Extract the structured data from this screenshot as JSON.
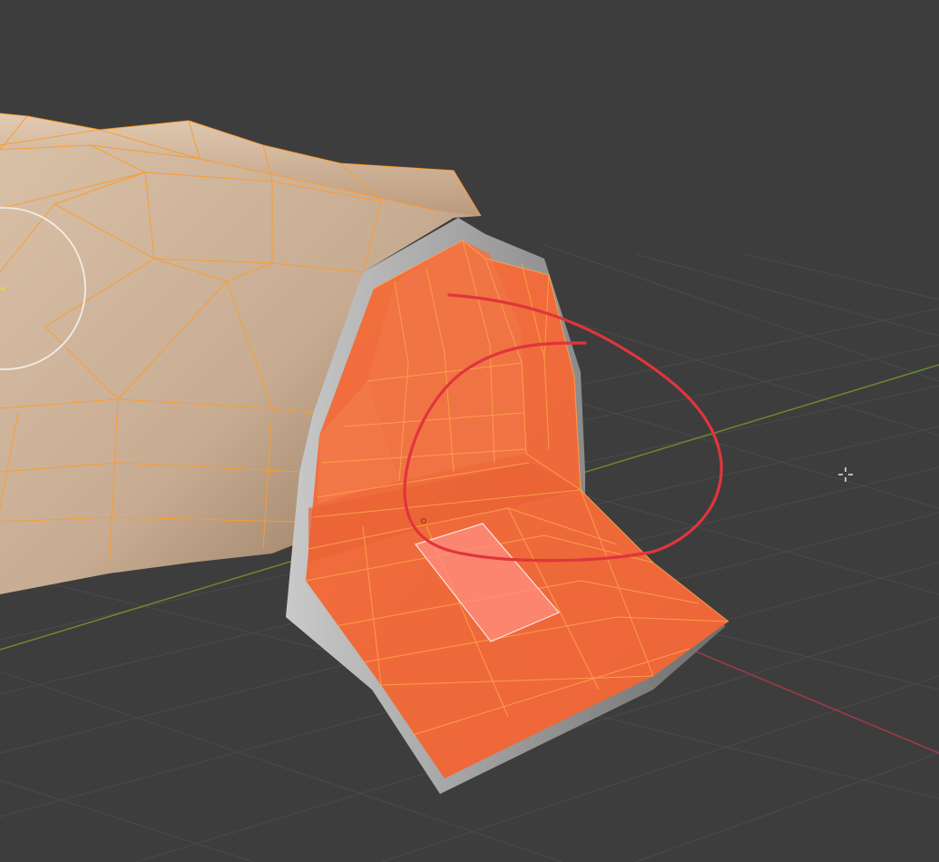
{
  "viewport": {
    "background": "#3d3d3d",
    "grid_color": "#4a4a4a",
    "x_axis_color": "#a33a48",
    "y_axis_color": "#6a8a2e",
    "mesh_body_color": "#c7ac92",
    "wire_color": "#ff9b2a",
    "selected_face_color": "#f06a3c",
    "active_face_color": "#ff8f82",
    "shadow_color": "#9a9a9a",
    "annotation_color": "#e0353c",
    "cursor_icon": "crosshair-cursor-icon"
  }
}
